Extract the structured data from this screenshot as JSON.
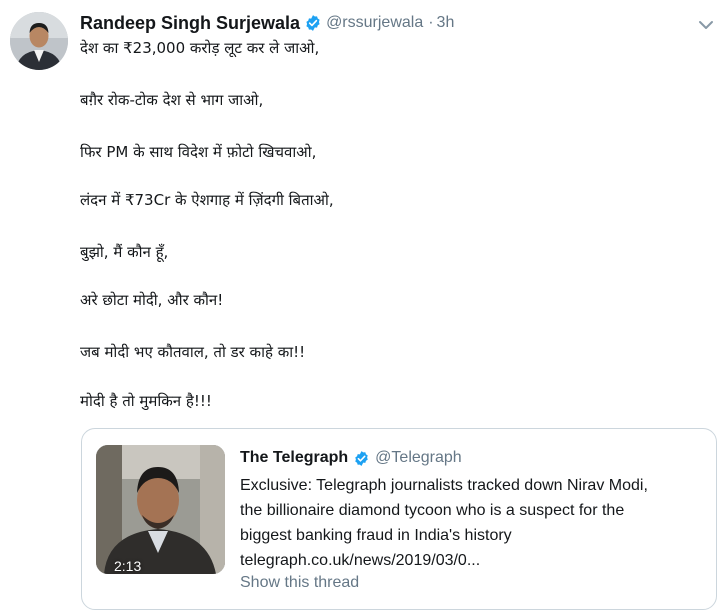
{
  "tweet": {
    "author": {
      "display_name": "Randeep Singh Surjewala",
      "handle": "@rssurjewala",
      "separator": "·",
      "time": "3h",
      "verified": true,
      "avatar_icon": "profile-photo"
    },
    "lines": [
      "देश का ₹23,000 करोड़ लूट कर ले जाओ,",
      "बग़ैर रोक-टोक देश से भाग जाओ,",
      "फिर PM के साथ विदेश में फ़ोटो खिचवाओ,",
      "लंदन में ₹73Cr के ऐशगाह में ज़िंदगी बिताओ,",
      "बुझो, मैं कौन हूँ,",
      "अरे छोटा मोदी, और कौन!",
      "जब मोदी भए कौतवाल, तो डर काहे का!!",
      "मोदी है तो मुमकिन है!!!"
    ],
    "menu_icon": "chevron-down-icon",
    "accent_color": "#1da1f2"
  },
  "quoted": {
    "display_name": "The Telegraph",
    "handle": "@Telegraph",
    "verified": true,
    "video_duration": "2:13",
    "text_lines": [
      "Exclusive: Telegraph journalists tracked down Nirav Modi,",
      "the billionaire diamond tycoon who is a suspect for the",
      "biggest banking fraud in India's history",
      "telegraph.co.uk/news/2019/03/0..."
    ],
    "show_thread": "Show this thread"
  }
}
